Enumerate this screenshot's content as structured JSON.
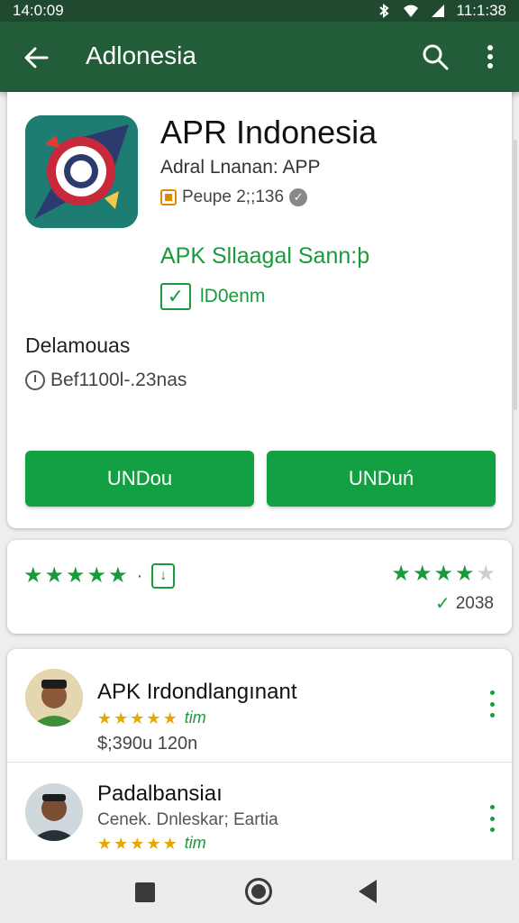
{
  "status_bar": {
    "time_left": "14:0:09",
    "time_right": "11:1:38"
  },
  "app_bar": {
    "title": "Adlonesia"
  },
  "app": {
    "name": "APR Indonesia",
    "developer": "Adral Lnanan: APP",
    "badge_text": "Peupe 2;;136",
    "tagline": "APK Sllaagal Sann:þ",
    "check_label": "lD0enm",
    "description_label": "Delamouas",
    "meta": "Bef1100l-.23nas",
    "button_left": "UNDou",
    "button_right": "UNDuń"
  },
  "rating": {
    "left_stars": 5,
    "right_stars": 4,
    "right_stars_total": 5,
    "count": "2038"
  },
  "list": [
    {
      "title": "APK  Irdondlangınant",
      "stars": 5,
      "tag": "tim",
      "price": "$;390u 120n"
    },
    {
      "title": "Padalbansiaı",
      "subtitle": "Cenek. Dnleskar; Eartia",
      "stars": 5,
      "tag": "tim"
    }
  ],
  "colors": {
    "primary": "#225c38",
    "accent": "#13a043",
    "star": "#e6a800"
  }
}
